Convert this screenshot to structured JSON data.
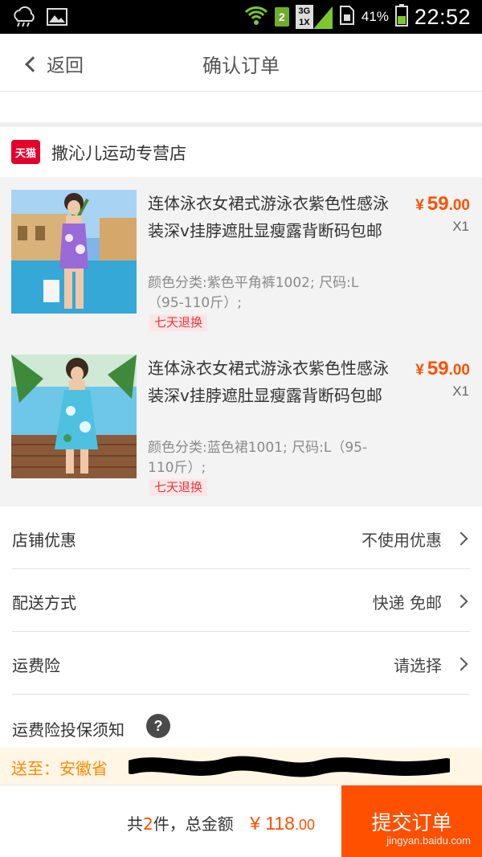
{
  "status_bar": {
    "time": "22:52",
    "battery": "41%",
    "sim_slot": "2",
    "network_top": "3G",
    "network_bottom": "1X",
    "icons": [
      "weather-icon",
      "image-icon",
      "wifi-icon",
      "signal-icon",
      "sim-card-icon",
      "battery-icon"
    ]
  },
  "nav": {
    "back_label": "返回",
    "title": "确认订单"
  },
  "store": {
    "badge": "天猫",
    "name": "撒沁儿运动专营店"
  },
  "items": [
    {
      "title": "连体泳衣女裙式游泳衣紫色性感泳装深v挂脖遮肚显瘦露背断码包邮",
      "sku": "颜色分类:紫色平角裤1002; 尺码:L（95-110斤）;",
      "tag": "七天退换",
      "price_currency": "¥",
      "price_int": "59",
      "price_dec": ".00",
      "qty": "X1"
    },
    {
      "title": "连体泳衣女裙式游泳衣紫色性感泳装深v挂脖遮肚显瘦露背断码包邮",
      "sku": "颜色分类:蓝色裙1001; 尺码:L（95-110斤）;",
      "tag": "七天退换",
      "price_currency": "¥",
      "price_int": "59",
      "price_dec": ".00",
      "qty": "X1"
    }
  ],
  "options": {
    "coupon": {
      "label": "店铺优惠",
      "value": "不使用优惠"
    },
    "delivery": {
      "label": "配送方式",
      "value": "快递 免邮"
    },
    "insurance": {
      "label": "运费险",
      "value": "请选择"
    },
    "insurance_notice": {
      "label": "运费险投保须知",
      "help": "?"
    }
  },
  "address": {
    "text": "送至：安徽省 "
  },
  "footer": {
    "prefix": "共",
    "count": "2",
    "suffix": "件，总金额",
    "currency": "¥",
    "amount_int": "118",
    "amount_dec": ".00",
    "submit_label": "提交订单",
    "watermark": "jingyan.baidu.com"
  },
  "colors": {
    "accent": "#ff5000",
    "tmall_red": "#e3002b",
    "address_orange": "#ff8a00",
    "status_green": "#6fae2d"
  }
}
